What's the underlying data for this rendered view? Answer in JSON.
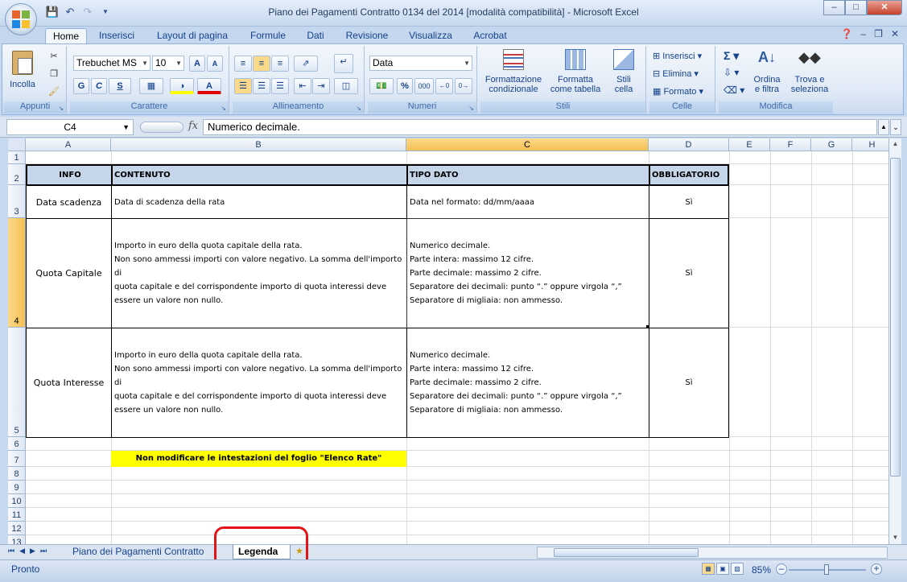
{
  "window": {
    "title": "Piano dei Pagamenti Contratto 0134 del 2014  [modalità compatibilità] - Microsoft Excel"
  },
  "ribbon": {
    "tabs": [
      "Home",
      "Inserisci",
      "Layout di pagina",
      "Formule",
      "Dati",
      "Revisione",
      "Visualizza",
      "Acrobat"
    ],
    "groups": {
      "appunti": "Appunti",
      "carattere": "Carattere",
      "allineamento": "Allineamento",
      "numeri": "Numeri",
      "stili": "Stili",
      "celle": "Celle",
      "modifica": "Modifica"
    },
    "incolla": "Incolla",
    "font_name": "Trebuchet MS",
    "font_size": "10",
    "number_format": "Data",
    "formattazione_condizionale_1": "Formattazione",
    "formattazione_condizionale_2": "condizionale",
    "formatta_tabella_1": "Formatta",
    "formatta_tabella_2": "come tabella",
    "stili_cella_1": "Stili",
    "stili_cella_2": "cella",
    "inserisci": "Inserisci",
    "elimina": "Elimina",
    "formato": "Formato",
    "ordina_1": "Ordina",
    "ordina_2": "e filtra",
    "trova_1": "Trova e",
    "trova_2": "seleziona",
    "bold": "G",
    "italic": "C",
    "underline": "S",
    "percent": "%",
    "thousands": "000"
  },
  "formula_bar": {
    "cell_ref": "C4",
    "fx": "fx",
    "content": "Numerico decimale."
  },
  "columns": [
    "A",
    "B",
    "C",
    "D",
    "E",
    "F",
    "G",
    "H"
  ],
  "rows": [
    "1",
    "2",
    "3",
    "4",
    "5",
    "6",
    "7",
    "8",
    "9",
    "10",
    "11",
    "12",
    "13"
  ],
  "table": {
    "headers": {
      "info": "INFO",
      "contenuto": "CONTENUTO",
      "tipo_dato": "TIPO DATO",
      "obbligatorio": "OBBLIGATORIO"
    },
    "row3": {
      "info": "Data scadenza",
      "contenuto": "Data di scadenza della rata",
      "tipo_dato": "Data nel formato: dd/mm/aaaa",
      "obbligatorio": "Sì"
    },
    "row4": {
      "info": "Quota Capitale",
      "contenuto_lines": [
        "Importo in euro della quota capitale della rata.",
        "Non sono ammessi importi con valore negativo. La somma dell'importo di",
        "quota capitale e del corrispondente importo di quota interessi deve",
        "essere un valore non nullo."
      ],
      "tipo_dato_lines": [
        "Numerico decimale.",
        "Parte intera: massimo 12 cifre.",
        "Parte decimale: massimo 2 cifre.",
        "Separatore dei decimali: punto “.” oppure virgola “,”",
        "Separatore di migliaia: non ammesso."
      ],
      "obbligatorio": "Sì"
    },
    "row5": {
      "info": "Quota Interesse",
      "contenuto_lines": [
        "Importo in euro della quota capitale della rata.",
        "Non sono ammessi importi con valore negativo. La somma dell'importo di",
        "quota capitale e del corrispondente importo di quota interessi deve",
        "essere un valore non nullo."
      ],
      "tipo_dato_lines": [
        "Numerico decimale.",
        "Parte intera: massimo 12 cifre.",
        "Parte decimale: massimo 2 cifre.",
        "Separatore dei decimali: punto “.” oppure virgola “,”",
        "Separatore di migliaia: non ammesso."
      ],
      "obbligatorio": "Sì"
    },
    "note": "Non modificare le intestazioni del foglio \"Elenco Rate\""
  },
  "sheets": {
    "tab1": "Piano dei Pagamenti Contratto C",
    "tab2": "Legenda"
  },
  "status": {
    "mode": "Pronto",
    "zoom": "85%"
  },
  "colors": {
    "header_fill": "#c5d5ea",
    "note_fill": "#ffff00",
    "annotation": "#e3151b",
    "selection": "#f5bf52"
  }
}
